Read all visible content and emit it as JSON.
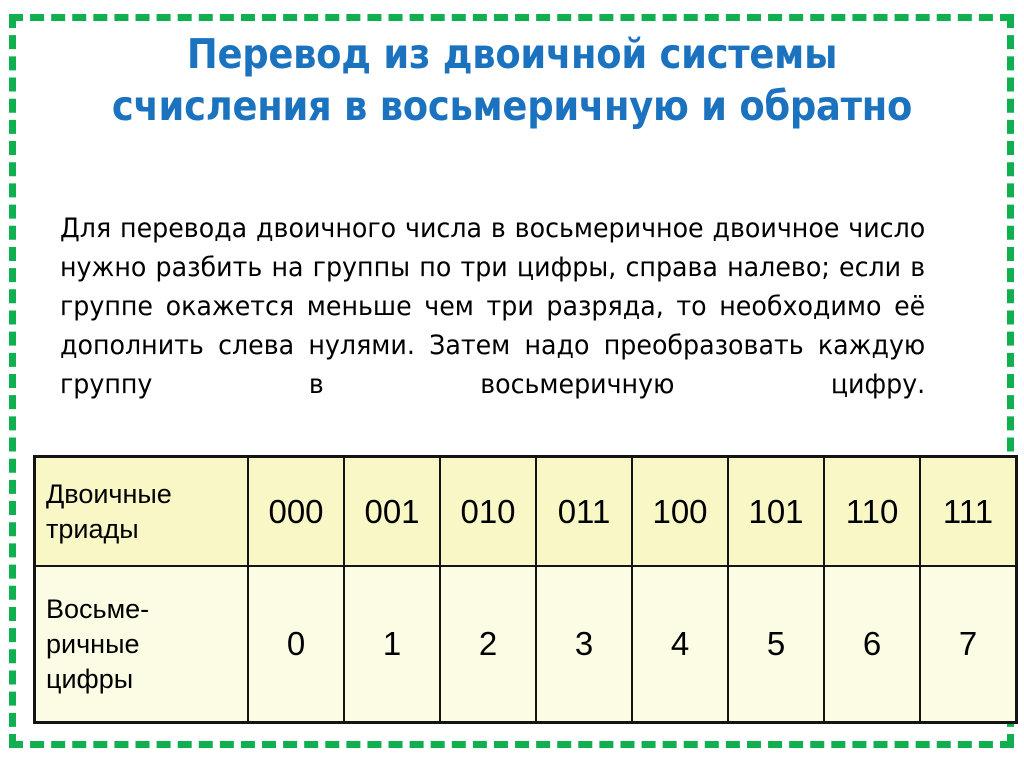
{
  "slide": {
    "title_lines": [
      "Перевод из двоичной системы",
      "счисления в восьмеричную и обратно"
    ],
    "body_text": "Для перевода двоичного числа в восьмеричное двоичное число нужно разбить на группы по три цифры, справа налево; если в группе окажется меньше чем три разряда, то необходимо её дополнить слева нулями. Затем надо преобразовать каждую группу в восьмеричную цифру.",
    "colors": {
      "title": "#1b72bf",
      "frame": "#10af50",
      "row1_bg": "#f8f7c5",
      "row2_bg": "#fcfce4",
      "border": "#141414",
      "text": "#000000",
      "background": "#ffffff"
    }
  },
  "table": {
    "rows": [
      {
        "label_lines": [
          "Двоичные",
          "триады"
        ],
        "label": "Двоичные триады",
        "values": [
          "000",
          "001",
          "010",
          "011",
          "100",
          "101",
          "110",
          "111"
        ]
      },
      {
        "label_lines": [
          "Восьме-",
          "ричные",
          "цифры"
        ],
        "label": "Восьмеричные цифры",
        "values": [
          "0",
          "1",
          "2",
          "3",
          "4",
          "5",
          "6",
          "7"
        ]
      }
    ]
  }
}
